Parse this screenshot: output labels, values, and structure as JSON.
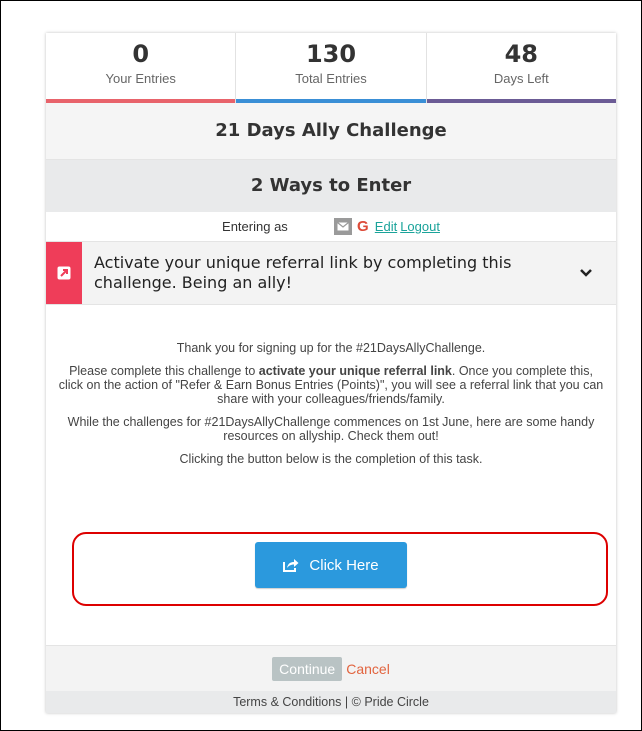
{
  "stats": [
    {
      "value": "0",
      "label": "Your Entries",
      "color": "#e8636b"
    },
    {
      "value": "130",
      "label": "Total Entries",
      "color": "#3a8fd6"
    },
    {
      "value": "48",
      "label": "Days Left",
      "color": "#6b5b95"
    }
  ],
  "campaign": {
    "title": "21 Days Ally Challenge",
    "ways_to_enter": "2 Ways to Enter"
  },
  "entering": {
    "label": "Entering as",
    "edit_label": "Edit",
    "logout_label": "Logout"
  },
  "action": {
    "text": "Activate your unique referral link by completing this challenge. Being an ally!",
    "icon": "external-link-icon",
    "color": "#ef3d59"
  },
  "body": {
    "p1": "Thank you for signing up for the #21DaysAllyChallenge.",
    "p2_before": "Please complete this challenge to ",
    "p2_bold": "activate your unique referral link",
    "p2_after": ". Once you complete this, click on the action of \"Refer & Earn Bonus Entries (Points)\", you will see a referral link that you can share with your colleagues/friends/family.",
    "p3": "While the challenges for #21DaysAllyChallenge commences on 1st June, here are some handy resources on allyship. Check them out!",
    "p4": "Clicking the button below is the completion of this task."
  },
  "cta": {
    "label": "Click Here",
    "color": "#2b99dd",
    "icon": "share-icon"
  },
  "footer": {
    "continue_label": "Continue",
    "cancel_label": "Cancel",
    "terms": "Terms & Conditions | © Pride Circle"
  }
}
